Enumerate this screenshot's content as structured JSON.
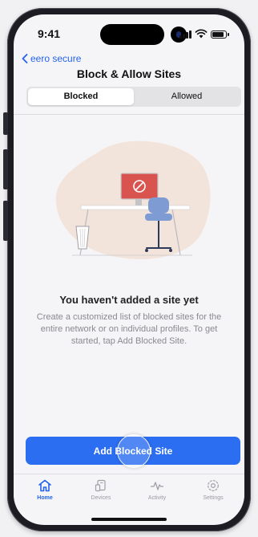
{
  "status_bar": {
    "time": "9:41"
  },
  "nav": {
    "back_label": "eero secure",
    "title": "Block & Allow Sites"
  },
  "segmented": {
    "tabs": [
      {
        "label": "Blocked"
      },
      {
        "label": "Allowed"
      }
    ]
  },
  "empty_state": {
    "title": "You haven't added a site yet",
    "description": "Create a customized list of blocked sites for the entire network or on individual profiles. To get started, tap Add Blocked Site."
  },
  "primary_action": {
    "label": "Add Blocked Site"
  },
  "tab_bar": {
    "items": [
      {
        "label": "Home",
        "icon": "home-icon",
        "active": true
      },
      {
        "label": "Devices",
        "icon": "devices-icon",
        "active": false
      },
      {
        "label": "Activity",
        "icon": "activity-icon",
        "active": false
      },
      {
        "label": "Settings",
        "icon": "settings-icon",
        "active": false
      }
    ]
  },
  "colors": {
    "accent": "#2463eb",
    "button": "#2b6ef2",
    "monitor": "#d9534f",
    "blob": "#f3e4db",
    "chair": "#7f9bd4"
  }
}
